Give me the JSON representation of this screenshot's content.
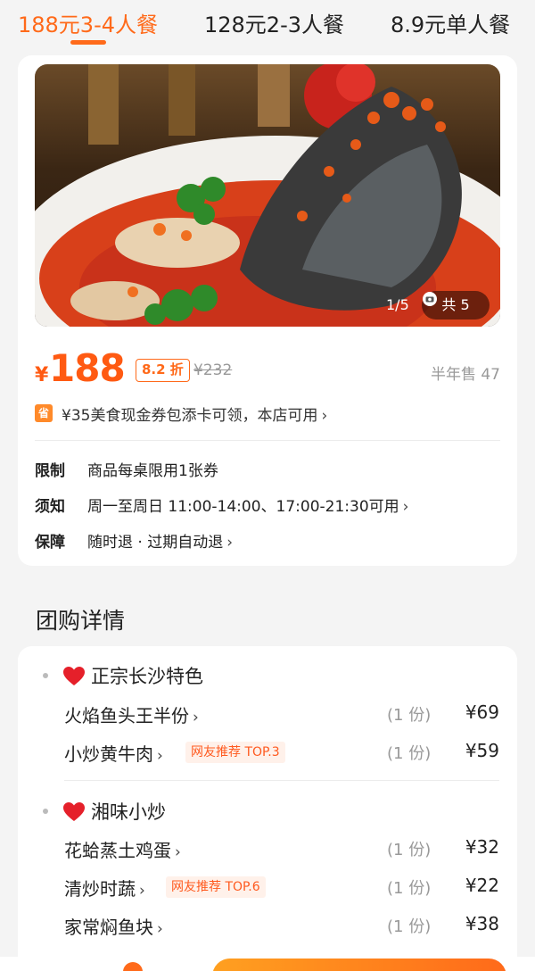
{
  "tabs": [
    {
      "label": "188元3-4人餐",
      "active": true
    },
    {
      "label": "128元2-3人餐",
      "active": false
    },
    {
      "label": "8.9元单人餐",
      "active": false
    }
  ],
  "gallery": {
    "counter": "1/5",
    "total_label": "共 5",
    "icon": "camera-icon"
  },
  "price": {
    "currency": "¥",
    "current": "188",
    "discount": "8.2 折",
    "original": "¥232",
    "sold": "半年售 47"
  },
  "coupon": {
    "icon_text": "省",
    "text": "¥35美食现金券包添卡可领，本店可用"
  },
  "info": [
    {
      "label": "限制",
      "value": "商品每桌限用1张券",
      "has_arrow": false
    },
    {
      "label": "须知",
      "value": "周一至周日 11:00-14:00、17:00-21:30可用",
      "has_arrow": true
    },
    {
      "label": "保障",
      "value": "随时退 · 过期自动退",
      "has_arrow": true
    }
  ],
  "section_title": "团购详情",
  "groups": [
    {
      "name": "正宗长沙特色",
      "items": [
        {
          "name": "火焰鱼头王半份",
          "tag": "",
          "qty": "(1 份)",
          "price": "¥69"
        },
        {
          "name": "小炒黄牛肉",
          "tag": "网友推荐 TOP.3",
          "qty": "(1 份)",
          "price": "¥59"
        }
      ]
    },
    {
      "name": "湘味小炒",
      "items": [
        {
          "name": "花蛤蒸土鸡蛋",
          "tag": "",
          "qty": "(1 份)",
          "price": "¥32"
        },
        {
          "name": "清炒时蔬",
          "tag": "网友推荐 TOP.6",
          "qty": "(1 份)",
          "price": "¥22"
        },
        {
          "name": "家常焖鱼块",
          "tag": "",
          "qty": "(1 份)",
          "price": "¥38"
        }
      ]
    }
  ],
  "colors": {
    "accent": "#ff6a1a",
    "price": "#ff5a12",
    "tag_bg": "#fff1ea"
  }
}
